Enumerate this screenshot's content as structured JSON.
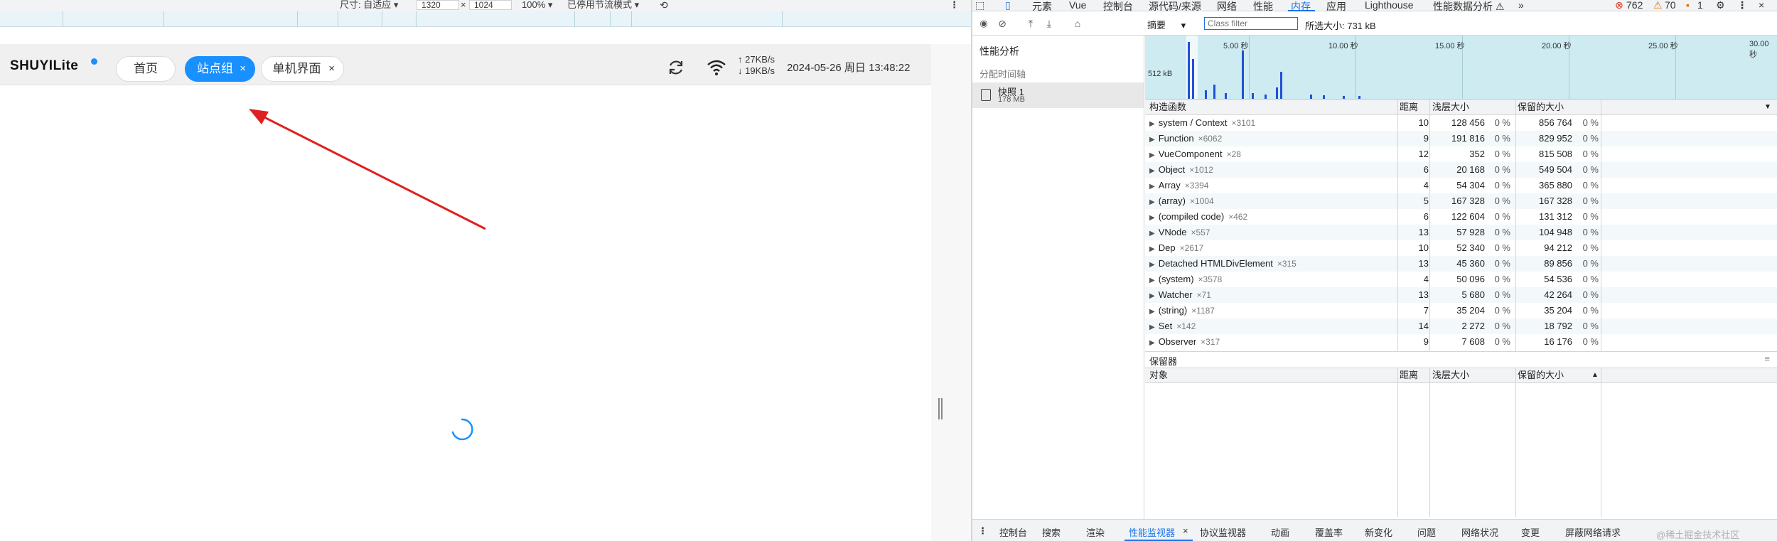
{
  "device_toolbar": {
    "dimensions_label": "尺寸: 自适应 ▾",
    "width": "1320",
    "times": "×",
    "height": "1024",
    "zoom": "100% ▾",
    "throttle": "已停用节流模式 ▾"
  },
  "app": {
    "logo": "SHUYILite",
    "tabs": [
      {
        "label": "首页",
        "closable": false,
        "active": false
      },
      {
        "label": "站点组",
        "closable": true,
        "active": true
      },
      {
        "label": "单机界面",
        "closable": true,
        "active": false
      }
    ],
    "close_glyph": "×",
    "net_up": "↑ 27KB/s",
    "net_down": "↓ 19KB/s",
    "datetime": "2024-05-26 周日 13:48:22",
    "accent_color": "#1890ff"
  },
  "devtools": {
    "panel_tabs": [
      "元素",
      "Vue",
      "控制台",
      "源代码/来源",
      "网络",
      "性能",
      "内存",
      "应用",
      "Lighthouse",
      "性能数据分析 ⚠"
    ],
    "active_panel": "内存",
    "more": "»",
    "errors": "762",
    "warnings": "70",
    "issues": "1",
    "view_select": "摘要",
    "class_filter_placeholder": "Class filter",
    "selected_size": "所选大小: 731 kB",
    "sidebar": {
      "perf_title": "性能分析",
      "alloc_title": "分配时间轴",
      "snapshot_name": "快照 1",
      "snapshot_size": "178 MB"
    },
    "timeline": {
      "labels": [
        "5.00 秒",
        "10.00 秒",
        "15.00 秒",
        "20.00 秒",
        "25.00 秒",
        "30.00 秒"
      ],
      "kb_label": "512 kB"
    },
    "columns": {
      "constructor": "构造函数",
      "distance": "距离",
      "shallow": "浅层大小",
      "retained": "保留的大小"
    },
    "rows": [
      {
        "name": "system / Context",
        "count": "×3101",
        "distance": "10",
        "shallow": "128 456",
        "shallow_pct": "0 %",
        "retained": "856 764",
        "retained_pct": "0 %"
      },
      {
        "name": "Function",
        "count": "×6062",
        "distance": "9",
        "shallow": "191 816",
        "shallow_pct": "0 %",
        "retained": "829 952",
        "retained_pct": "0 %"
      },
      {
        "name": "VueComponent",
        "count": "×28",
        "distance": "12",
        "shallow": "352",
        "shallow_pct": "0 %",
        "retained": "815 508",
        "retained_pct": "0 %"
      },
      {
        "name": "Object",
        "count": "×1012",
        "distance": "6",
        "shallow": "20 168",
        "shallow_pct": "0 %",
        "retained": "549 504",
        "retained_pct": "0 %"
      },
      {
        "name": "Array",
        "count": "×3394",
        "distance": "4",
        "shallow": "54 304",
        "shallow_pct": "0 %",
        "retained": "365 880",
        "retained_pct": "0 %"
      },
      {
        "name": "(array)",
        "count": "×1004",
        "distance": "5",
        "shallow": "167 328",
        "shallow_pct": "0 %",
        "retained": "167 328",
        "retained_pct": "0 %"
      },
      {
        "name": "(compiled code)",
        "count": "×462",
        "distance": "6",
        "shallow": "122 604",
        "shallow_pct": "0 %",
        "retained": "131 312",
        "retained_pct": "0 %"
      },
      {
        "name": "VNode",
        "count": "×557",
        "distance": "13",
        "shallow": "57 928",
        "shallow_pct": "0 %",
        "retained": "104 948",
        "retained_pct": "0 %"
      },
      {
        "name": "Dep",
        "count": "×2617",
        "distance": "10",
        "shallow": "52 340",
        "shallow_pct": "0 %",
        "retained": "94 212",
        "retained_pct": "0 %"
      },
      {
        "name": "Detached HTMLDivElement",
        "count": "×315",
        "distance": "13",
        "shallow": "45 360",
        "shallow_pct": "0 %",
        "retained": "89 856",
        "retained_pct": "0 %"
      },
      {
        "name": "(system)",
        "count": "×3578",
        "distance": "4",
        "shallow": "50 096",
        "shallow_pct": "0 %",
        "retained": "54 536",
        "retained_pct": "0 %"
      },
      {
        "name": "Watcher",
        "count": "×71",
        "distance": "13",
        "shallow": "5 680",
        "shallow_pct": "0 %",
        "retained": "42 264",
        "retained_pct": "0 %"
      },
      {
        "name": "(string)",
        "count": "×1187",
        "distance": "7",
        "shallow": "35 204",
        "shallow_pct": "0 %",
        "retained": "35 204",
        "retained_pct": "0 %"
      },
      {
        "name": "Set",
        "count": "×142",
        "distance": "14",
        "shallow": "2 272",
        "shallow_pct": "0 %",
        "retained": "18 792",
        "retained_pct": "0 %"
      },
      {
        "name": "Observer",
        "count": "×317",
        "distance": "9",
        "shallow": "7 608",
        "shallow_pct": "0 %",
        "retained": "16 176",
        "retained_pct": "0 %"
      }
    ],
    "retainers": {
      "title": "保留器",
      "object": "对象",
      "distance": "距离",
      "shallow": "浅层大小",
      "retained": "保留的大小"
    },
    "drawer_tabs": [
      "控制台",
      "搜索",
      "渲染",
      "性能监视器",
      "协议监视器",
      "动画",
      "覆盖率",
      "新变化",
      "问题",
      "网络状况",
      "变更",
      "屏蔽网络请求"
    ],
    "drawer_active": "性能监视器"
  },
  "watermark": "@稀土掘金技术社区"
}
